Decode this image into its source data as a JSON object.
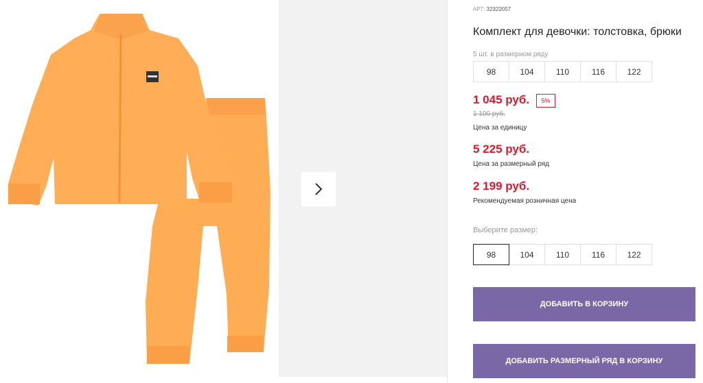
{
  "product": {
    "art_label": "АРТ:",
    "art_number": "32322057",
    "title": "Комплект для девочки: толстовка, брюки",
    "image_icon": "orange-tracksuit-image",
    "garment_color": "#ffab4f"
  },
  "gallery": {
    "next_icon": "chevron-right-icon"
  },
  "pack": {
    "caption": "5 шт. в размерном ряду",
    "sizes": [
      "98",
      "104",
      "110",
      "116",
      "122"
    ]
  },
  "pricing": {
    "unit_price": "1 045 руб.",
    "discount": "5%",
    "old_price": "1 100 руб.",
    "unit_caption": "Цена за единицу",
    "pack_price": "5 225 руб.",
    "pack_caption": "Цена за размерный ряд",
    "retail_price": "2 199 руб.",
    "retail_caption": "Рекомендуемая розничная цена",
    "accent_color": "#e3162b"
  },
  "size_select": {
    "label": "Выберите размер:",
    "options": [
      "98",
      "104",
      "110",
      "116",
      "122"
    ],
    "selected": "98"
  },
  "actions": {
    "add_to_cart": "ДОБАВИТЬ В КОРЗИНУ",
    "add_pack_to_cart": "ДОБАВИТЬ РАЗМЕРНЫЙ РЯД В КОРЗИНУ",
    "button_color": "#7a68a6"
  }
}
